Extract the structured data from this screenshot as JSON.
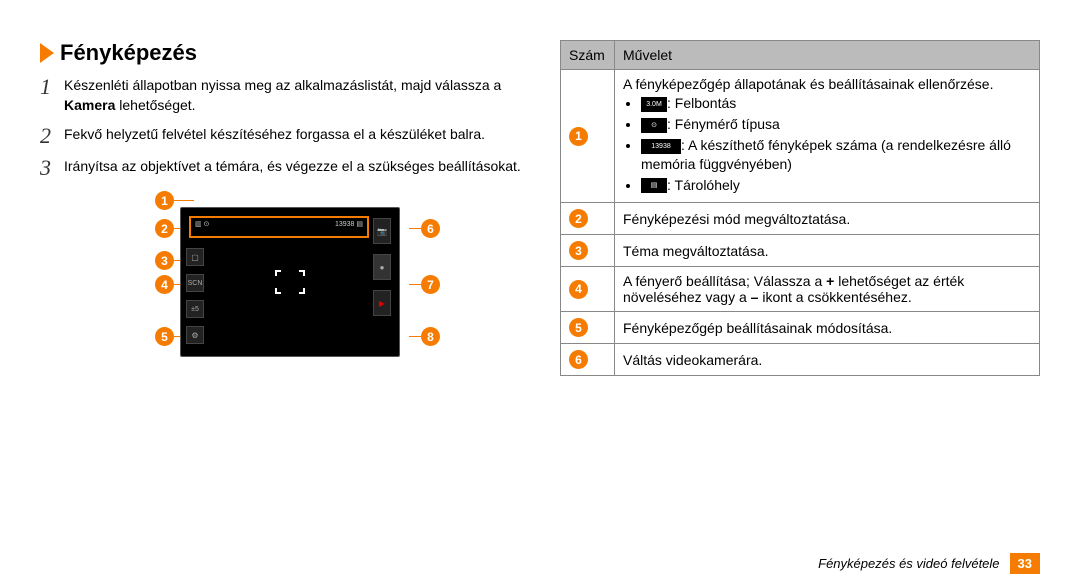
{
  "heading": "Fényképezés",
  "steps": [
    {
      "num": "1",
      "prefix": "Készenléti állapotban nyissa meg az alkalmazáslistát, majd válassza a ",
      "bold": "Kamera",
      "suffix": " lehetőséget."
    },
    {
      "num": "2",
      "prefix": "Fekvő helyzetű felvétel készítéséhez forgassa el a készüléket balra.",
      "bold": "",
      "suffix": ""
    },
    {
      "num": "3",
      "prefix": "Irányítsa az objektívet a témára, és végezze el a szükséges beállításokat.",
      "bold": "",
      "suffix": ""
    }
  ],
  "callouts": [
    "1",
    "2",
    "3",
    "4",
    "5",
    "6",
    "7",
    "8"
  ],
  "topbar_left": "▥ ⊙",
  "topbar_right": "13938 ▤",
  "table": {
    "head": [
      "Szám",
      "Művelet"
    ],
    "rows": [
      {
        "num": "1",
        "intro": "A fényképezőgép állapotának és beállításainak ellenőrzése.",
        "items": [
          {
            "icon": "3.0M",
            "wide": false,
            "text": ": Felbontás"
          },
          {
            "icon": "⊙",
            "wide": false,
            "text": ": Fénymérő típusa"
          },
          {
            "icon": "13938",
            "wide": true,
            "text": ": A készíthető fényképek száma (a rendelkezésre álló memória függvényében)"
          },
          {
            "icon": "▤",
            "wide": false,
            "text": ": Tárolóhely"
          }
        ]
      },
      {
        "num": "2",
        "text": "Fényképezési mód megváltoztatása."
      },
      {
        "num": "3",
        "text": "Téma megváltoztatása."
      },
      {
        "num": "4",
        "text_pre": "A fényerő beállítása; Válassza a ",
        "b1": "+",
        "text_mid": " lehetőséget az érték növeléséhez vagy a ",
        "b2": "–",
        "text_post": " ikont a csökkentéséhez."
      },
      {
        "num": "5",
        "text": "Fényképezőgép beállításainak módosítása."
      },
      {
        "num": "6",
        "text": "Váltás videokamerára."
      }
    ]
  },
  "footer": {
    "title": "Fényképezés és videó felvétele",
    "page": "33"
  }
}
